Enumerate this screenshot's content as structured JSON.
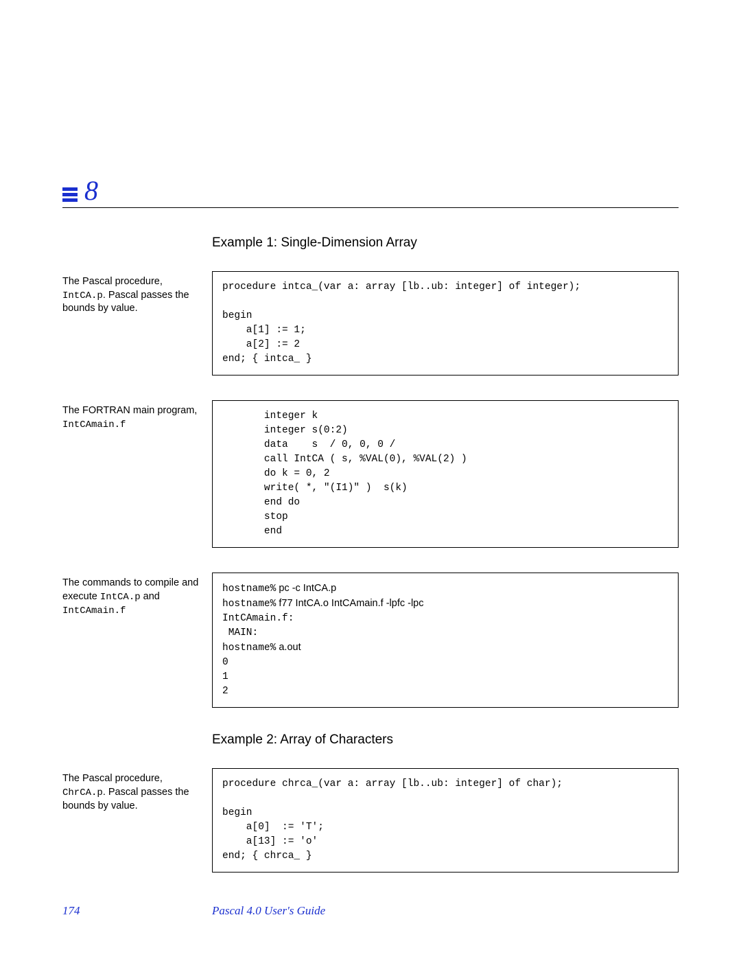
{
  "chapter": {
    "number": "8"
  },
  "example1": {
    "heading": "Example 1: Single-Dimension Array",
    "block1_note_l1": "The Pascal procedure,",
    "block1_note_l2a": "IntCA.p",
    "block1_note_l2b": ". Pascal passes the",
    "block1_note_l3": "bounds by value.",
    "block1_code": "procedure intca_(var a: array [lb..ub: integer] of integer);\n\nbegin\n    a[1] := 1;\n    a[2] := 2\nend; { intca_ }",
    "block2_note_l1": "The FORTRAN main program,",
    "block2_note_l2": "IntCAmain.f",
    "block2_code": "       integer k\n       integer s(0:2)\n       data    s  / 0, 0, 0 /\n       call IntCA ( s, %VAL(0), %VAL(2) )\n       do k = 0, 2\n       write( *, \"(I1)\" )  s(k)\n       end do\n       stop\n       end",
    "block3_note_l1": "The commands to compile and",
    "block3_note_l2a": "execute ",
    "block3_note_l2b": "IntCA.p",
    "block3_note_l2c": " and",
    "block3_note_l3": "IntCAmain.f",
    "block3_prompt": "hostname%",
    "block3_cmd1": " pc -c IntCA.p",
    "block3_cmd2": " f77 IntCA.o IntCAmain.f -lpfc -lpc",
    "block3_out1": "IntCAmain.f:",
    "block3_out2": " MAIN:",
    "block3_cmd3": " a.out",
    "block3_out3": "0",
    "block3_out4": "1",
    "block3_out5": "2"
  },
  "example2": {
    "heading": "Example 2: Array of Characters",
    "block1_note_l1": "The Pascal procedure,",
    "block1_note_l2a": "ChrCA.p",
    "block1_note_l2b": ". Pascal passes the",
    "block1_note_l3": "bounds by value.",
    "block1_code": "procedure chrca_(var a: array [lb..ub: integer] of char);\n\nbegin\n    a[0]  := 'T';\n    a[13] := 'o'\nend; { chrca_ }"
  },
  "footer": {
    "page": "174",
    "guide": "Pascal 4.0 User's Guide"
  }
}
